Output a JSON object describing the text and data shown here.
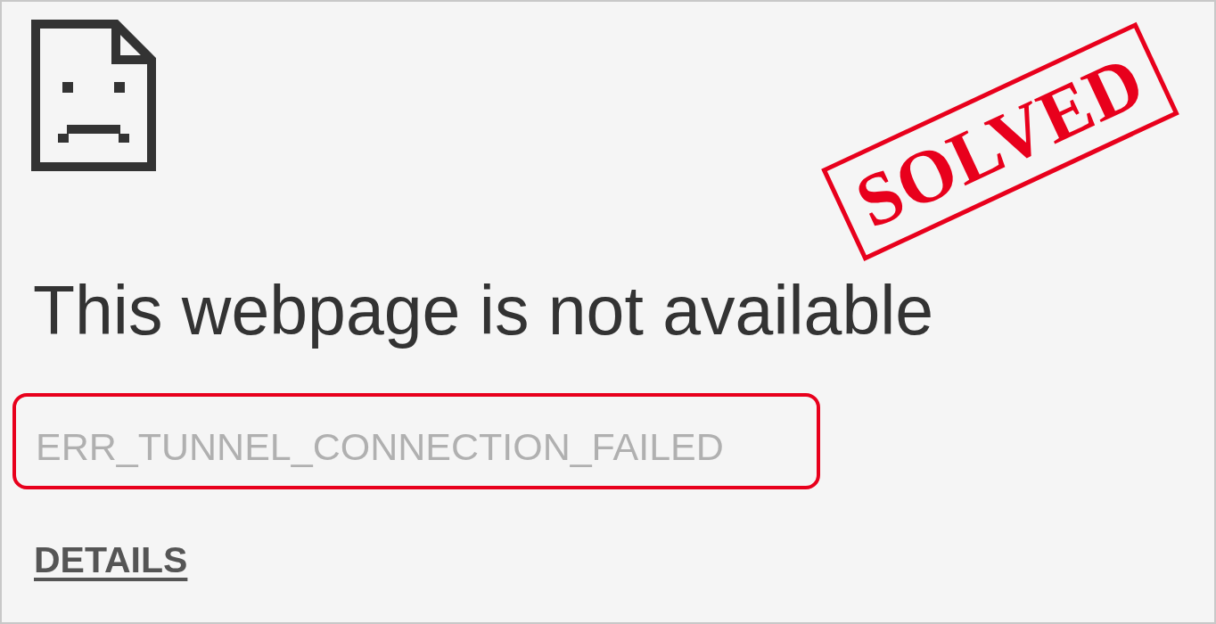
{
  "page": {
    "heading": "This webpage is not available",
    "error_code": {
      "text": "ERR_TUNNEL_CONNECTION_FAILED",
      "highlighted": true
    },
    "details_link": "DETAILS"
  },
  "stamp": {
    "text": "SOLVED"
  }
}
